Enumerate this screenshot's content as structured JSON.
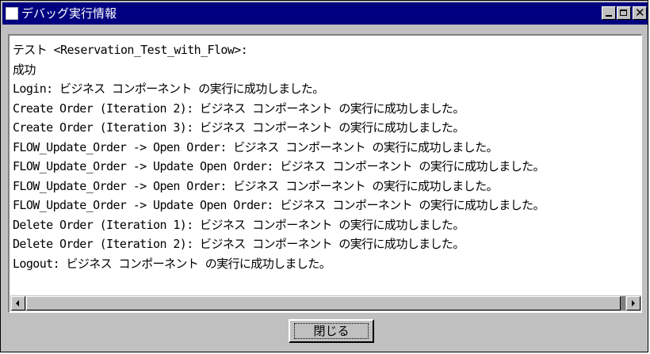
{
  "window": {
    "title": "デバッグ実行情報",
    "close_glyph": "✕"
  },
  "log": {
    "lines": [
      "テスト <Reservation_Test_with_Flow>:",
      "成功",
      "Login: ビジネス コンポーネント の実行に成功しました。",
      "Create Order (Iteration 2): ビジネス コンポーネント の実行に成功しました。",
      "Create Order (Iteration 3): ビジネス コンポーネント の実行に成功しました。",
      "FLOW_Update_Order -> Open Order: ビジネス コンポーネント の実行に成功しました。",
      "FLOW_Update_Order -> Update Open Order: ビジネス コンポーネント の実行に成功しました。",
      "FLOW_Update_Order -> Open Order: ビジネス コンポーネント の実行に成功しました。",
      "FLOW_Update_Order -> Update Open Order: ビジネス コンポーネント の実行に成功しました。",
      "Delete Order (Iteration 1): ビジネス コンポーネント の実行に成功しました。",
      "Delete Order (Iteration 2): ビジネス コンポーネント の実行に成功しました。",
      "Logout: ビジネス コンポーネント の実行に成功しました。"
    ]
  },
  "footer": {
    "close_label": "閉じる"
  }
}
